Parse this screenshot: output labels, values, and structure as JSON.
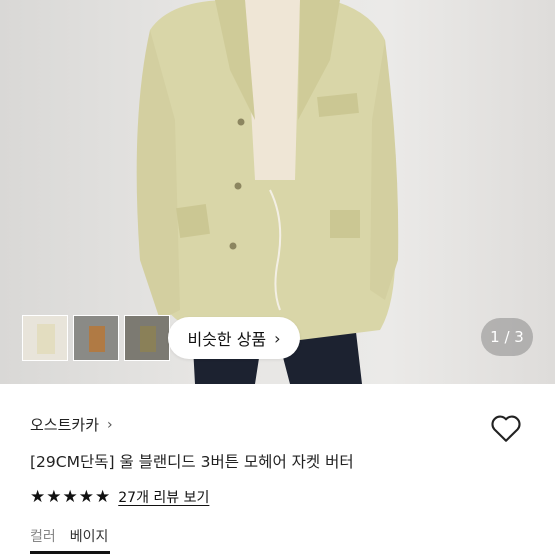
{
  "gallery": {
    "similar_button_label": "비슷한 상품",
    "counter": "1 / 3",
    "current_image": 1,
    "total_images": 3,
    "thumbnails": [
      "thumbnail-1",
      "thumbnail-2",
      "thumbnail-3"
    ]
  },
  "product": {
    "brand": "오스트카카",
    "title": "[29CM단독] 울 블랜디드 3버튼 모헤어 자켓 버터",
    "rating": 5,
    "rating_max": 5,
    "review_link": "27개 리뷰 보기",
    "color_label": "컬러",
    "color_value": "베이지"
  },
  "colors": {
    "jacket": "#d9d6a8",
    "text": "#111111",
    "muted": "#888888"
  },
  "icons": {
    "brand_chevron": "chevron-right-icon",
    "similar_chevron": "chevron-right-icon",
    "wishlist": "heart-outline-icon",
    "star": "star-filled-icon"
  }
}
